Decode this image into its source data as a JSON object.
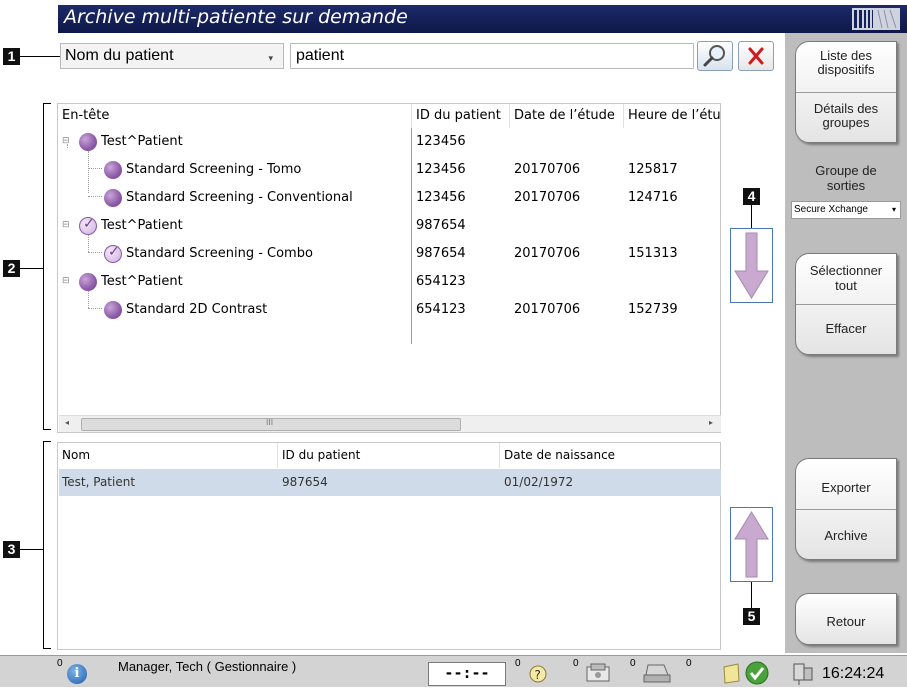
{
  "title": "Archive multi-patiente sur demande",
  "search": {
    "field": "Nom du patient",
    "value": "patient"
  },
  "callouts": [
    "1",
    "2",
    "3",
    "4",
    "5"
  ],
  "studies": {
    "headers": [
      "En-tête",
      "ID du patient",
      "Date de l’étude",
      "Heure de l’étud"
    ],
    "rows": [
      {
        "name": "Test^Patient",
        "id": "123456",
        "date": "",
        "time": ""
      },
      {
        "name": "Standard Screening - Tomo",
        "id": "123456",
        "date": "20170706",
        "time": "125817"
      },
      {
        "name": "Standard Screening - Conventional",
        "id": "123456",
        "date": "20170706",
        "time": "124716"
      },
      {
        "name": "Test^Patient",
        "id": "987654",
        "date": "",
        "time": ""
      },
      {
        "name": "Standard Screening - Combo",
        "id": "987654",
        "date": "20170706",
        "time": "151313"
      },
      {
        "name": "Test^Patient",
        "id": "654123",
        "date": "",
        "time": ""
      },
      {
        "name": "Standard 2D Contrast",
        "id": "654123",
        "date": "20170706",
        "time": "152739"
      }
    ],
    "scroll_grip": "III"
  },
  "patients": {
    "headers": [
      "Nom",
      "ID du patient",
      "Date de naissance"
    ],
    "rows": [
      {
        "name": "Test, Patient",
        "id": "987654",
        "dob": "01/02/1972"
      }
    ]
  },
  "sidebar": {
    "device_list": "Liste des dispositifs",
    "group_details": "Détails des groupes",
    "output_group_label": "Groupe de sorties",
    "output_group_value": "Secure Xchange",
    "select_all": "Sélectionner tout",
    "clear": "Effacer",
    "export": "Exporter",
    "archive": "Archive",
    "back": "Retour"
  },
  "statusbar": {
    "alert_count": "0",
    "user": "Manager, Tech ( Gestionnaire )",
    "timer": "--:--",
    "count_help": "0",
    "count_media": "0",
    "count_print": "0",
    "count_other": "0",
    "clock": "16:24:24"
  },
  "colors": {
    "title_bar": "#15215a",
    "selected_row": "#cfdbe8",
    "arrow_fill": "#c9a9cf",
    "side_panel": "#bdbdbd",
    "status_bar": "#d3d3d3"
  }
}
